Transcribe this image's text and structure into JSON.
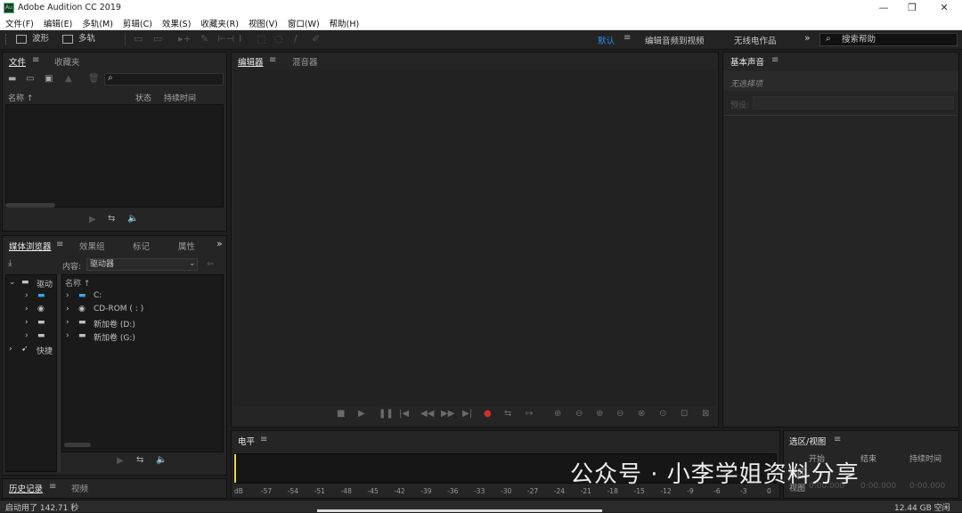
{
  "app": {
    "title": "Adobe Audition CC 2019",
    "logo_text": "Au"
  },
  "window_controls": {
    "minimize": "—",
    "restore": "❐",
    "close": "✕"
  },
  "menu": [
    "文件(F)",
    "编辑(E)",
    "多轨(M)",
    "剪辑(C)",
    "效果(S)",
    "收藏夹(R)",
    "视图(V)",
    "窗口(W)",
    "帮助(H)"
  ],
  "toolbar": {
    "waveform": "波形",
    "multitrack": "多轨"
  },
  "workspaces": {
    "default": "默认",
    "edit_video": "编辑音频到视频",
    "radio": "无线电作品",
    "more": "»"
  },
  "help_search": {
    "placeholder": "搜索帮助"
  },
  "files_panel": {
    "tabs": [
      "文件",
      "收藏夹"
    ],
    "columns": {
      "name": "名称 ↑",
      "status": "状态",
      "duration": "持续时间"
    }
  },
  "media_panel": {
    "tabs": [
      "媒体浏览器",
      "效果组",
      "标记",
      "属性"
    ],
    "more": "»",
    "content_label": "内容:",
    "content_value": "驱动器",
    "tree": [
      {
        "label": "驱动",
        "level": 0,
        "expanded": true
      },
      {
        "label": "",
        "level": 1
      },
      {
        "label": "",
        "level": 1
      },
      {
        "label": "",
        "level": 1
      },
      {
        "label": "",
        "level": 1
      },
      {
        "label": "快捷",
        "level": 0
      }
    ],
    "list_header": "名称 ↑",
    "drives": [
      "C:",
      "CD-ROM ( : )",
      "新加卷 (D:)",
      "新加卷 (G:)"
    ]
  },
  "history_panel": {
    "tabs": [
      "历史记录",
      "视频"
    ]
  },
  "editor_panel": {
    "tabs": [
      "编辑器",
      "混音器"
    ]
  },
  "essential_sound": {
    "title": "基本声音",
    "no_selection": "无选择项",
    "preset_label": "预设:"
  },
  "level_panel": {
    "title": "电平",
    "scale": [
      "dB",
      "-57",
      "-54",
      "-51",
      "-48",
      "-45",
      "-42",
      "-39",
      "-36",
      "-33",
      "-30",
      "-27",
      "-24",
      "-21",
      "-18",
      "-15",
      "-12",
      "-9",
      "-6",
      "-3",
      "0"
    ]
  },
  "selection_panel": {
    "title": "选区/视图",
    "columns": [
      "开始",
      "结束",
      "持续时间"
    ],
    "rows": [
      "选区",
      "视图"
    ],
    "values": [
      "0:00.000",
      "0:00.000",
      "0:00.000"
    ]
  },
  "status": {
    "left": "启动用了 142.71 秒",
    "right": "12.44 GB 空闲"
  },
  "watermark": "公众号 · 小李学姐资料分享",
  "colors": {
    "accent_blue": "#2d8ceb",
    "record_red": "#d0312d",
    "playhead_yellow": "#e5d64a",
    "panel_bg": "#252525",
    "well_bg": "#1a1a1a"
  }
}
